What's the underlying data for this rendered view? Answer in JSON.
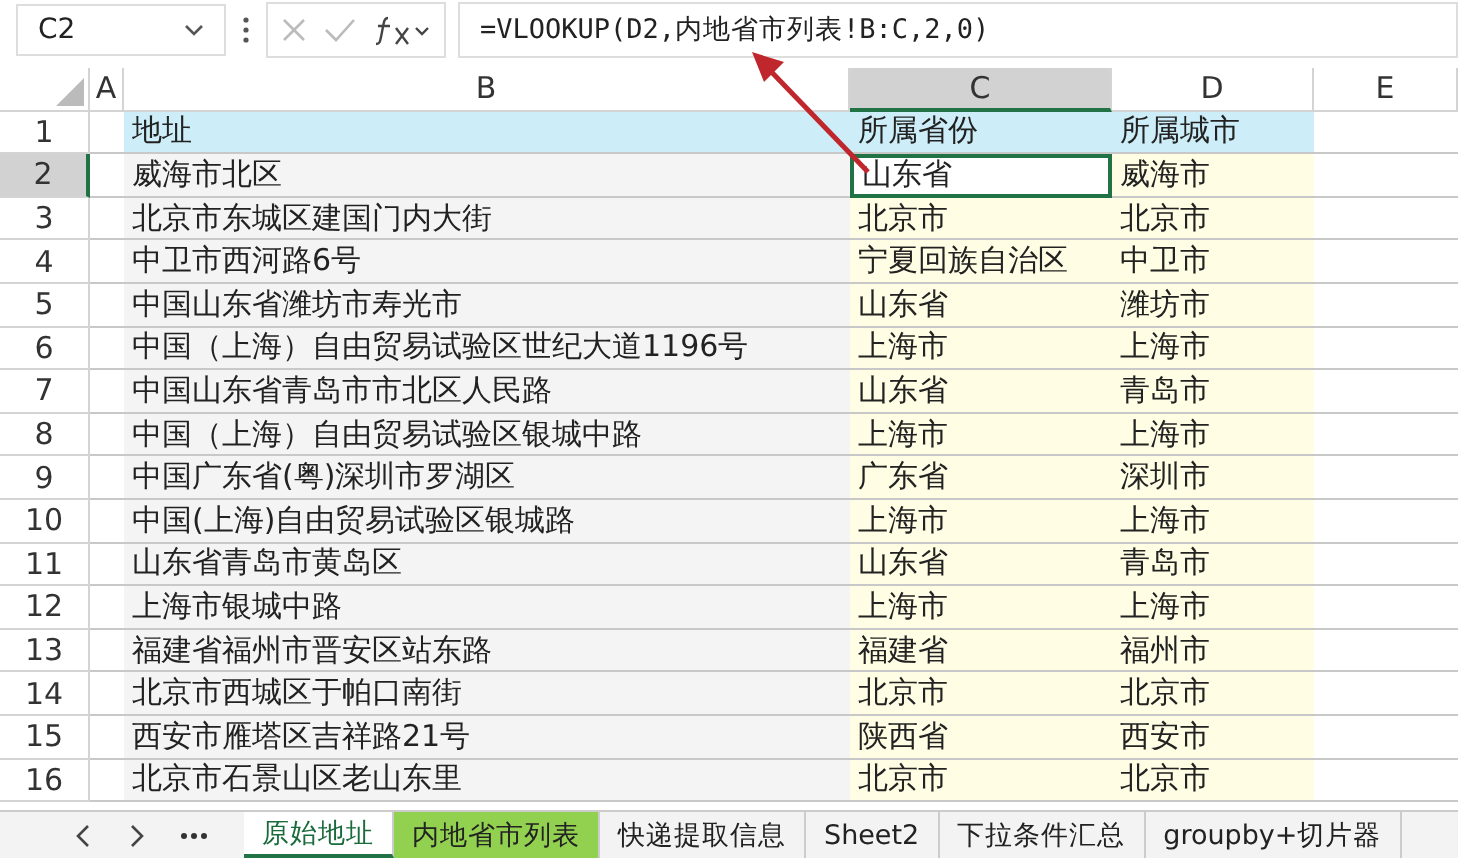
{
  "formula_bar": {
    "name_box": "C2",
    "formula": "=VLOOKUP(D2,内地省市列表!B:C,2,0)"
  },
  "columns": [
    {
      "label": "A",
      "selected": false
    },
    {
      "label": "B",
      "selected": false
    },
    {
      "label": "C",
      "selected": true
    },
    {
      "label": "D",
      "selected": false
    },
    {
      "label": "E",
      "selected": false
    }
  ],
  "rows": [
    {
      "number": "1",
      "kind": "header",
      "selected": false,
      "cells": [
        "地址",
        "所属省份",
        "所属城市"
      ]
    },
    {
      "number": "2",
      "kind": "data",
      "selected": true,
      "cells": [
        "威海市北区",
        "山东省",
        "威海市"
      ]
    },
    {
      "number": "3",
      "kind": "data",
      "selected": false,
      "cells": [
        "北京市东城区建国门内大街",
        "北京市",
        "北京市"
      ]
    },
    {
      "number": "4",
      "kind": "data",
      "selected": false,
      "cells": [
        "中卫市西河路6号",
        "宁夏回族自治区",
        "中卫市"
      ]
    },
    {
      "number": "5",
      "kind": "data",
      "selected": false,
      "cells": [
        "中国山东省潍坊市寿光市",
        "山东省",
        "潍坊市"
      ]
    },
    {
      "number": "6",
      "kind": "data",
      "selected": false,
      "cells": [
        "中国（上海）自由贸易试验区世纪大道1196号",
        "上海市",
        "上海市"
      ]
    },
    {
      "number": "7",
      "kind": "data",
      "selected": false,
      "cells": [
        "中国山东省青岛市市北区人民路",
        "山东省",
        "青岛市"
      ]
    },
    {
      "number": "8",
      "kind": "data",
      "selected": false,
      "cells": [
        "中国（上海）自由贸易试验区银城中路",
        "上海市",
        "上海市"
      ]
    },
    {
      "number": "9",
      "kind": "data",
      "selected": false,
      "cells": [
        "中国广东省(粤)深圳市罗湖区",
        "广东省",
        "深圳市"
      ]
    },
    {
      "number": "10",
      "kind": "data",
      "selected": false,
      "cells": [
        "中国(上海)自由贸易试验区银城路",
        "上海市",
        "上海市"
      ]
    },
    {
      "number": "11",
      "kind": "data",
      "selected": false,
      "cells": [
        "山东省青岛市黄岛区",
        "山东省",
        "青岛市"
      ]
    },
    {
      "number": "12",
      "kind": "data",
      "selected": false,
      "cells": [
        "上海市银城中路",
        "上海市",
        "上海市"
      ]
    },
    {
      "number": "13",
      "kind": "data",
      "selected": false,
      "cells": [
        "福建省福州市晋安区站东路",
        "福建省",
        "福州市"
      ]
    },
    {
      "number": "14",
      "kind": "data",
      "selected": false,
      "cells": [
        "北京市西城区于帕口南街",
        "北京市",
        "北京市"
      ]
    },
    {
      "number": "15",
      "kind": "data",
      "selected": false,
      "cells": [
        "西安市雁塔区吉祥路21号",
        "陕西省",
        "西安市"
      ]
    },
    {
      "number": "16",
      "kind": "data",
      "selected": false,
      "cells": [
        "北京市石景山区老山东里",
        "北京市",
        "北京市"
      ]
    }
  ],
  "sheet_tabs": [
    {
      "label": "原始地址",
      "selected": true
    },
    {
      "label": "内地省市列表",
      "selected": false,
      "color": "#92d050"
    },
    {
      "label": "快递提取信息",
      "selected": false
    },
    {
      "label": "Sheet2",
      "selected": false
    },
    {
      "label": "下拉条件汇总",
      "selected": false
    },
    {
      "label": "groupby+切片器",
      "selected": false
    }
  ]
}
